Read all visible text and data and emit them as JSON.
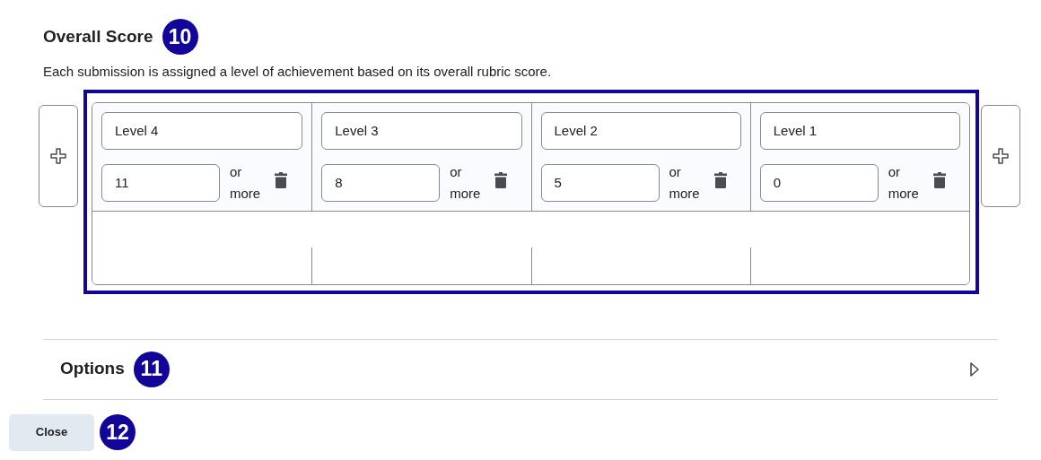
{
  "section": {
    "title": "Overall Score",
    "badge": "10",
    "description": "Each submission is assigned a level of achievement based on its overall rubric score."
  },
  "levels": [
    {
      "name": "Level 4",
      "score": "11",
      "suffix": "or more"
    },
    {
      "name": "Level 3",
      "score": "8",
      "suffix": "or more"
    },
    {
      "name": "Level 2",
      "score": "5",
      "suffix": "or more"
    },
    {
      "name": "Level 1",
      "score": "0",
      "suffix": "or more"
    }
  ],
  "options": {
    "title": "Options",
    "badge": "11",
    "expanded": false
  },
  "close_button": {
    "label": "Close",
    "badge": "12"
  }
}
